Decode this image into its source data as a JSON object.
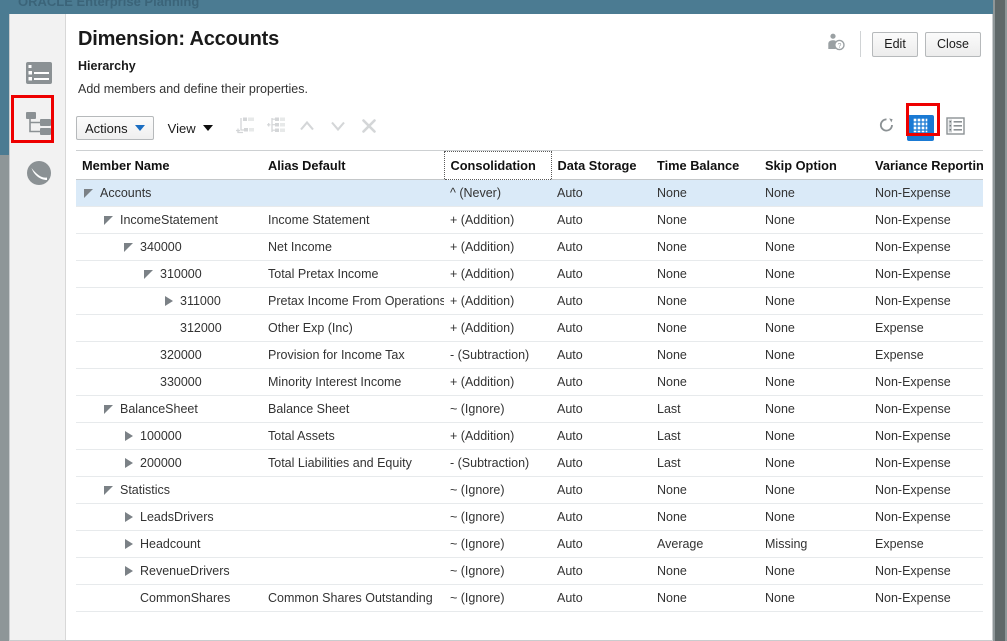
{
  "background": {
    "ghost_text": "ORACLE  Enterprise Planning",
    "header_color": "#4b7b92"
  },
  "sidebar": {
    "items": [
      {
        "name": "properties-icon",
        "label": "Properties",
        "active": false
      },
      {
        "name": "hierarchy-icon",
        "label": "Hierarchy",
        "active": true
      },
      {
        "name": "evaluation-order-icon",
        "label": "Evaluation Order",
        "active": false
      }
    ]
  },
  "header": {
    "title": "Dimension: Accounts",
    "subtitle": "Hierarchy",
    "description": "Add members and define their properties.",
    "member_info_icon": "user-question-icon",
    "edit_label": "Edit",
    "close_label": "Close"
  },
  "toolbar": {
    "actions_label": "Actions",
    "view_label": "View",
    "icons": [
      {
        "name": "add-child-icon",
        "enabled": false
      },
      {
        "name": "add-sibling-icon",
        "enabled": false
      },
      {
        "name": "move-up-icon",
        "enabled": false
      },
      {
        "name": "move-down-icon",
        "enabled": false
      },
      {
        "name": "delete-icon",
        "enabled": false
      }
    ],
    "refresh_icon": "refresh-icon",
    "grid_view_icon": "grid-view-icon",
    "grid_view_active": true,
    "list_view_icon": "list-view-icon",
    "accent_color": "#1a7ad4"
  },
  "table": {
    "columns": [
      "Member Name",
      "Alias Default",
      "Consolidation",
      "Data Storage",
      "Time Balance",
      "Skip Option",
      "Variance Reporting"
    ],
    "selected_column": "Consolidation",
    "rows": [
      {
        "indent": 0,
        "twisty": "open",
        "member": "Accounts",
        "alias": "",
        "consolidation": "^ (Never)",
        "storage": "Auto",
        "time_balance": "None",
        "skip": "None",
        "variance": "Non-Expense",
        "selected": true
      },
      {
        "indent": 1,
        "twisty": "open",
        "member": "IncomeStatement",
        "alias": "Income Statement",
        "consolidation": "+ (Addition)",
        "storage": "Auto",
        "time_balance": "None",
        "skip": "None",
        "variance": "Non-Expense",
        "selected": false
      },
      {
        "indent": 2,
        "twisty": "open",
        "member": "340000",
        "alias": "Net Income",
        "consolidation": "+ (Addition)",
        "storage": "Auto",
        "time_balance": "None",
        "skip": "None",
        "variance": "Non-Expense",
        "selected": false
      },
      {
        "indent": 3,
        "twisty": "open",
        "member": "310000",
        "alias": "Total Pretax Income",
        "consolidation": "+ (Addition)",
        "storage": "Auto",
        "time_balance": "None",
        "skip": "None",
        "variance": "Non-Expense",
        "selected": false
      },
      {
        "indent": 4,
        "twisty": "closed",
        "member": "311000",
        "alias": "Pretax Income From Operations",
        "consolidation": "+ (Addition)",
        "storage": "Auto",
        "time_balance": "None",
        "skip": "None",
        "variance": "Non-Expense",
        "selected": false
      },
      {
        "indent": 4,
        "twisty": "none",
        "member": "312000",
        "alias": "Other Exp (Inc)",
        "consolidation": "+ (Addition)",
        "storage": "Auto",
        "time_balance": "None",
        "skip": "None",
        "variance": "Expense",
        "selected": false
      },
      {
        "indent": 3,
        "twisty": "none",
        "member": "320000",
        "alias": "Provision for Income Tax",
        "consolidation": "- (Subtraction)",
        "storage": "Auto",
        "time_balance": "None",
        "skip": "None",
        "variance": "Expense",
        "selected": false
      },
      {
        "indent": 3,
        "twisty": "none",
        "member": "330000",
        "alias": "Minority Interest Income",
        "consolidation": "+ (Addition)",
        "storage": "Auto",
        "time_balance": "None",
        "skip": "None",
        "variance": "Non-Expense",
        "selected": false
      },
      {
        "indent": 1,
        "twisty": "open",
        "member": "BalanceSheet",
        "alias": "Balance Sheet",
        "consolidation": "~ (Ignore)",
        "storage": "Auto",
        "time_balance": "Last",
        "skip": "None",
        "variance": "Non-Expense",
        "selected": false
      },
      {
        "indent": 2,
        "twisty": "closed",
        "member": "100000",
        "alias": "Total Assets",
        "consolidation": "+ (Addition)",
        "storage": "Auto",
        "time_balance": "Last",
        "skip": "None",
        "variance": "Non-Expense",
        "selected": false
      },
      {
        "indent": 2,
        "twisty": "closed",
        "member": "200000",
        "alias": "Total Liabilities and Equity",
        "consolidation": "- (Subtraction)",
        "storage": "Auto",
        "time_balance": "Last",
        "skip": "None",
        "variance": "Non-Expense",
        "selected": false
      },
      {
        "indent": 1,
        "twisty": "open",
        "member": "Statistics",
        "alias": "",
        "consolidation": "~ (Ignore)",
        "storage": "Auto",
        "time_balance": "None",
        "skip": "None",
        "variance": "Non-Expense",
        "selected": false
      },
      {
        "indent": 2,
        "twisty": "closed",
        "member": "LeadsDrivers",
        "alias": "",
        "consolidation": "~ (Ignore)",
        "storage": "Auto",
        "time_balance": "None",
        "skip": "None",
        "variance": "Non-Expense",
        "selected": false
      },
      {
        "indent": 2,
        "twisty": "closed",
        "member": "Headcount",
        "alias": "",
        "consolidation": "~ (Ignore)",
        "storage": "Auto",
        "time_balance": "Average",
        "skip": "Missing",
        "variance": "Expense",
        "selected": false
      },
      {
        "indent": 2,
        "twisty": "closed",
        "member": "RevenueDrivers",
        "alias": "",
        "consolidation": "~ (Ignore)",
        "storage": "Auto",
        "time_balance": "None",
        "skip": "None",
        "variance": "Non-Expense",
        "selected": false
      },
      {
        "indent": 2,
        "twisty": "none",
        "member": "CommonShares",
        "alias": "Common Shares Outstanding",
        "consolidation": "~ (Ignore)",
        "storage": "Auto",
        "time_balance": "None",
        "skip": "None",
        "variance": "Non-Expense",
        "selected": false
      }
    ]
  },
  "annotations": [
    {
      "name": "hierarchy-icon-highlight",
      "color": "#ee0000"
    },
    {
      "name": "grid-view-highlight",
      "color": "#ee0000"
    }
  ]
}
